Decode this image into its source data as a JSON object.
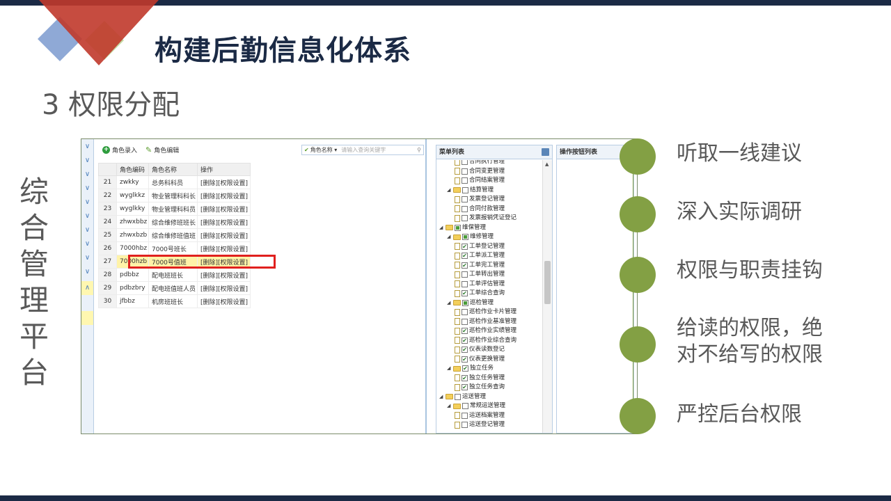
{
  "slide": {
    "title": "构建后勤信息化体系",
    "subtitle": "3  权限分配",
    "side_label": [
      "综",
      "合",
      "管",
      "理",
      "平",
      "台"
    ],
    "colors": {
      "dark_navy": "#1b2a45",
      "accent_red": "#c0392b",
      "accent_blue": "#7f9fd0",
      "accent_green": "#83a044",
      "highlight_box": "#e0201e"
    }
  },
  "toolbar": {
    "add_label": "角色录入",
    "edit_label": "角色编辑",
    "filter_label": "角色名称",
    "search_placeholder": "请输入查询关键字"
  },
  "grid": {
    "headers": [
      "角色编码",
      "角色名称",
      "操作"
    ],
    "rows": [
      {
        "num": "21",
        "code": "zwkky",
        "name": "总务科科员",
        "op": "[删除][权限设置]"
      },
      {
        "num": "22",
        "code": "wyglkkz",
        "name": "物业管理科科长",
        "op": "[删除][权限设置]"
      },
      {
        "num": "23",
        "code": "wyglkky",
        "name": "物业管理科科员",
        "op": "[删除][权限设置]"
      },
      {
        "num": "24",
        "code": "zhwxbbz",
        "name": "综合维修班班长",
        "op": "[删除][权限设置]"
      },
      {
        "num": "25",
        "code": "zhwxbzb",
        "name": "综合维修班值班",
        "op": "[删除][权限设置]"
      },
      {
        "num": "26",
        "code": "7000hbz",
        "name": "7000号班长",
        "op": "[删除][权限设置]"
      },
      {
        "num": "27",
        "code": "7000hzb",
        "name": "7000号值班",
        "op": "[删除][权限设置]"
      },
      {
        "num": "28",
        "code": "pdbbz",
        "name": "配电班班长",
        "op": "[删除][权限设置]"
      },
      {
        "num": "29",
        "code": "pdbzbry",
        "name": "配电班值班人员",
        "op": "[删除][权限设置]"
      },
      {
        "num": "30",
        "code": "jfbbz",
        "name": "机房班班长",
        "op": "[删除][权限设置]"
      }
    ]
  },
  "menu_panel": {
    "title": "菜单列表",
    "tree": [
      {
        "label": "合同执行管理",
        "level": 2,
        "type": "leaf",
        "check": "none"
      },
      {
        "label": "合同变更管理",
        "level": 2,
        "type": "leaf",
        "check": "none"
      },
      {
        "label": "合同结案管理",
        "level": 2,
        "type": "leaf",
        "check": "none"
      },
      {
        "label": "结算管理",
        "level": 1,
        "type": "folder",
        "check": "none"
      },
      {
        "label": "发票登记管理",
        "level": 2,
        "type": "leaf",
        "check": "none"
      },
      {
        "label": "合同付款管理",
        "level": 2,
        "type": "leaf",
        "check": "none"
      },
      {
        "label": "发票报销凭证登记",
        "level": 2,
        "type": "leaf",
        "check": "none"
      },
      {
        "label": "维保管理",
        "level": 0,
        "type": "folder",
        "check": "partial"
      },
      {
        "label": "维修管理",
        "level": 1,
        "type": "folder",
        "check": "partial"
      },
      {
        "label": "工单登记管理",
        "level": 2,
        "type": "leaf",
        "check": "checked"
      },
      {
        "label": "工单派工管理",
        "level": 2,
        "type": "leaf",
        "check": "checked"
      },
      {
        "label": "工单完工管理",
        "level": 2,
        "type": "leaf",
        "check": "checked"
      },
      {
        "label": "工单转出管理",
        "level": 2,
        "type": "leaf",
        "check": "none"
      },
      {
        "label": "工单评估管理",
        "level": 2,
        "type": "leaf",
        "check": "none"
      },
      {
        "label": "工单综合查询",
        "level": 2,
        "type": "leaf",
        "check": "checked"
      },
      {
        "label": "巡检管理",
        "level": 1,
        "type": "folder",
        "check": "partial"
      },
      {
        "label": "巡检作业卡片管理",
        "level": 2,
        "type": "leaf",
        "check": "none"
      },
      {
        "label": "巡检作业基准管理",
        "level": 2,
        "type": "leaf",
        "check": "none"
      },
      {
        "label": "巡检作业实绩管理",
        "level": 2,
        "type": "leaf",
        "check": "checked"
      },
      {
        "label": "巡检作业综合查询",
        "level": 2,
        "type": "leaf",
        "check": "checked"
      },
      {
        "label": "仪表读数登记",
        "level": 2,
        "type": "leaf",
        "check": "checked"
      },
      {
        "label": "仪表更换管理",
        "level": 2,
        "type": "leaf",
        "check": "checked"
      },
      {
        "label": "独立任务",
        "level": 1,
        "type": "folder",
        "check": "checked"
      },
      {
        "label": "独立任务管理",
        "level": 2,
        "type": "leaf",
        "check": "checked"
      },
      {
        "label": "独立任务查询",
        "level": 2,
        "type": "leaf",
        "check": "checked"
      },
      {
        "label": "运送管理",
        "level": 0,
        "type": "folder",
        "check": "none"
      },
      {
        "label": "常规运送管理",
        "level": 1,
        "type": "folder",
        "check": "none"
      },
      {
        "label": "运送档案管理",
        "level": 2,
        "type": "leaf",
        "check": "none"
      },
      {
        "label": "运送登记管理",
        "level": 2,
        "type": "leaf",
        "check": "none"
      }
    ]
  },
  "ops_panel": {
    "title": "操作按钮列表"
  },
  "bullets": [
    {
      "lines": [
        "听取一线建议"
      ]
    },
    {
      "lines": [
        "深入实际调研"
      ]
    },
    {
      "lines": [
        "权限与职责挂钩"
      ]
    },
    {
      "lines": [
        "给读的权限，绝",
        "对不给写的权限"
      ]
    },
    {
      "lines": [
        "严控后台权限"
      ]
    }
  ]
}
